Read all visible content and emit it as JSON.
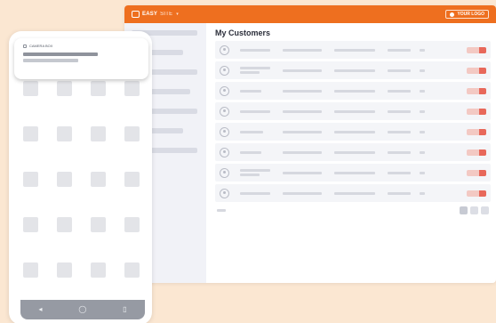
{
  "dashboard": {
    "brand": {
      "name": "EASY",
      "accent": "SITE",
      "color": "#ee6f1f"
    },
    "user": {
      "label": "YOUR LOGO"
    },
    "title": "My Customers",
    "sidebar_item_count": 7,
    "row_count": 8,
    "accent_red": "#e8685a"
  },
  "mobile": {
    "notification": {
      "title": "CAMERA BOX"
    },
    "nav": {
      "back": "◂",
      "home": "◯",
      "recent": "▯"
    }
  },
  "icons": [
    "logo-mark",
    "user-avatar",
    "customer-avatar",
    "notification-icon"
  ]
}
